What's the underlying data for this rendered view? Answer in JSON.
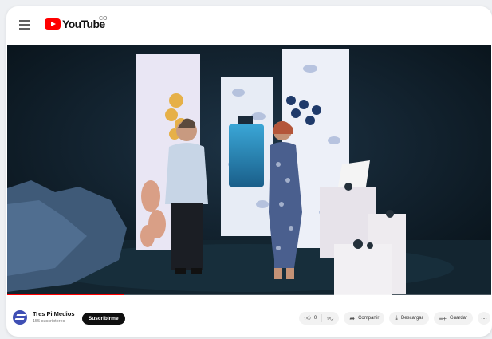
{
  "header": {
    "menu_icon": "hamburger-menu-icon",
    "logo_text": "YouTube",
    "country_code": "CO"
  },
  "video": {
    "progress_fraction": 0.24,
    "progress_color": "#ff0000"
  },
  "channel": {
    "name": "Tres Pi Medios",
    "subscribers": "155 suscriptores",
    "subscribe_label": "Suscribirme"
  },
  "actions": {
    "likes": "0",
    "share_label": "Compartir",
    "download_label": "Descargar",
    "save_label": "Guardar"
  },
  "colors": {
    "brand_red": "#ff0000",
    "subscribe_bg": "#0f0f0f"
  }
}
